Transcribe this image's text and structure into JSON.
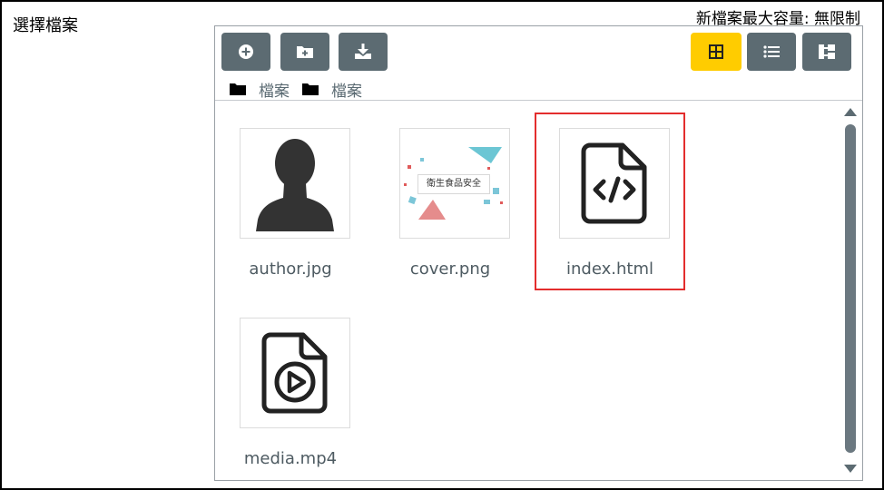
{
  "header": {
    "select_label": "選擇檔案",
    "max_size_label": "新檔案最大容量: 無限制"
  },
  "toolbar": {
    "buttons": [
      {
        "name": "add",
        "icon": "plus-circle-icon"
      },
      {
        "name": "new-folder",
        "icon": "folder-plus-icon"
      },
      {
        "name": "download",
        "icon": "download-icon"
      }
    ],
    "views": [
      {
        "name": "grid",
        "icon": "grid-view-icon",
        "active": true
      },
      {
        "name": "list",
        "icon": "list-view-icon",
        "active": false
      },
      {
        "name": "tree",
        "icon": "tree-view-icon",
        "active": false
      }
    ],
    "active_color": "#ffcc00",
    "button_color": "#5c6b72"
  },
  "breadcrumb": [
    {
      "label": "檔案",
      "icon": "folder-icon"
    },
    {
      "label": "檔案",
      "icon": "folder-icon"
    }
  ],
  "files": [
    {
      "name": "author.jpg",
      "icon": "person-silhouette-icon",
      "selected": false
    },
    {
      "name": "cover.png",
      "icon": "image-thumbnail",
      "thumb_text": "衛生食品安全",
      "selected": false
    },
    {
      "name": "index.html",
      "icon": "code-file-icon",
      "selected": true
    },
    {
      "name": "media.mp4",
      "icon": "video-file-icon",
      "selected": false
    }
  ],
  "selection_color": "#e32d2d"
}
